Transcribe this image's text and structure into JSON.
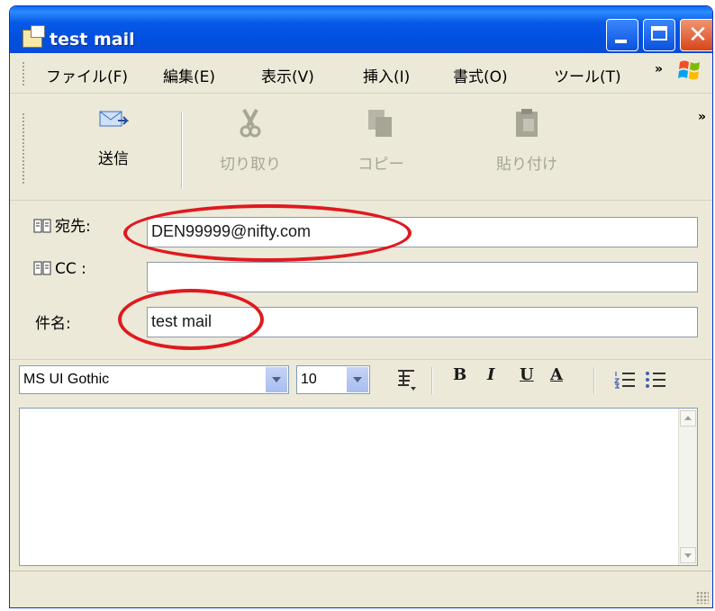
{
  "window": {
    "title": "test mail"
  },
  "menu": {
    "items": [
      "ファイル(F)",
      "編集(E)",
      "表示(V)",
      "挿入(I)",
      "書式(O)",
      "ツール(T)"
    ],
    "overflow": "»"
  },
  "toolbar": {
    "send_label": "送信",
    "cut_label": "切り取り",
    "copy_label": "コピー",
    "paste_label": "貼り付け",
    "overflow": "»"
  },
  "header": {
    "to_label": "宛先:",
    "to_value": "DEN99999@nifty.com",
    "cc_label": "CC :",
    "cc_value": "",
    "subject_label": "件名:",
    "subject_value": "test mail"
  },
  "format": {
    "font_name": "MS UI Gothic",
    "font_size": "10",
    "bold": "B",
    "italic": "I",
    "underline": "U",
    "font_color": "A"
  },
  "body": {
    "text": ""
  },
  "colors": {
    "highlight": "#E0191F",
    "title_bar": "#0A4BD6"
  }
}
